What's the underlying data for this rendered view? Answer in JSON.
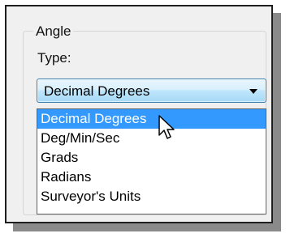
{
  "group": {
    "legend": "Angle"
  },
  "type_label": "Type:",
  "combo": {
    "selected_value": "Decimal Degrees",
    "arrow_icon": "chevron-down-icon"
  },
  "dropdown": {
    "options": [
      {
        "label": "Decimal Degrees",
        "selected": true
      },
      {
        "label": "Deg/Min/Sec",
        "selected": false
      },
      {
        "label": "Grads",
        "selected": false
      },
      {
        "label": "Radians",
        "selected": false
      },
      {
        "label": "Surveyor's Units",
        "selected": false
      }
    ]
  },
  "cursor_icon": "mouse-pointer-icon",
  "colors": {
    "selection": "#3399ff",
    "combo_border": "#3c7fb1",
    "dialog_bg": "#f0f0f0"
  }
}
